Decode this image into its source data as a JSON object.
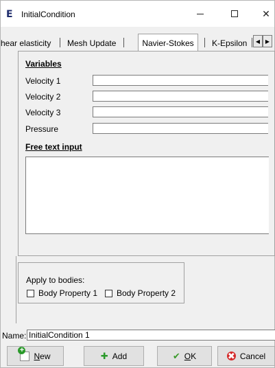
{
  "window": {
    "title": "InitialCondition",
    "app_icon": "E",
    "minimize_icon": "minimize-icon",
    "maximize_icon": "maximize-icon",
    "close_icon": "close-icon",
    "close_glyph": "✕"
  },
  "tabs": [
    {
      "label": "hear elasticity"
    },
    {
      "label": "Mesh Update"
    },
    {
      "label": "Navier-Stokes",
      "active": true
    },
    {
      "label": "K-Epsilon"
    }
  ],
  "tab_scroll": {
    "left": "◀",
    "right": "▶"
  },
  "variables": {
    "title": "Variables",
    "fields": [
      {
        "label": "Velocity 1",
        "value": ""
      },
      {
        "label": "Velocity 2",
        "value": ""
      },
      {
        "label": "Velocity 3",
        "value": ""
      },
      {
        "label": "Pressure",
        "value": ""
      }
    ]
  },
  "free_text": {
    "title": "Free text input",
    "value": ""
  },
  "bodies": {
    "label": "Apply to bodies:",
    "items": [
      {
        "label": "Body Property 1",
        "checked": false
      },
      {
        "label": "Body Property 2",
        "checked": false
      }
    ]
  },
  "name": {
    "label": "Name:",
    "value": "InitialCondition 1"
  },
  "buttons": {
    "new_label": "New",
    "new_mnemonic": "N",
    "new_rest": "ew",
    "add_label": "Add",
    "ok_label": "OK",
    "ok_mnemonic": "O",
    "ok_rest": "K",
    "cancel_label": "Cancel",
    "add_glyph": "✚",
    "ok_glyph": "✔",
    "cancel_glyph": "✖"
  },
  "colors": {
    "window_bg": "#f0f0f0",
    "button_bg": "#e1e1e1",
    "add_green": "#2a9a2a",
    "cancel_red": "#d42a2a"
  }
}
